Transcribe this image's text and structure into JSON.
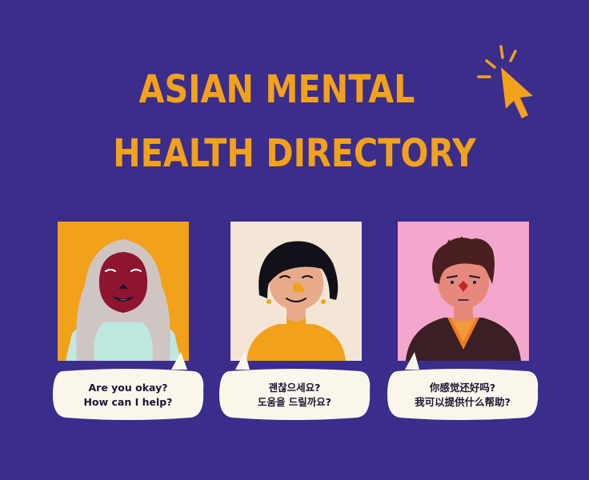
{
  "title": {
    "line1": "ASIAN MENTAL",
    "line2": "HEALTH DIRECTORY"
  },
  "icons": {
    "cursor": "cursor-click-icon"
  },
  "colors": {
    "background": "#3a2d8c",
    "accent": "#f2a11b",
    "bubble": "#fbf6ec",
    "card_1_bg": "#f2a11b",
    "card_2_bg": "#f3e6d6",
    "card_3_bg": "#f4a7cc"
  },
  "bubbles": [
    {
      "line1": "Are you okay?",
      "line2": "How can I help?"
    },
    {
      "line1": "괜찮으세요?",
      "line2": "도움을 드릴까요?"
    },
    {
      "line1": "你感觉还好吗?",
      "line2": "我可以提供什么帮助?"
    }
  ]
}
